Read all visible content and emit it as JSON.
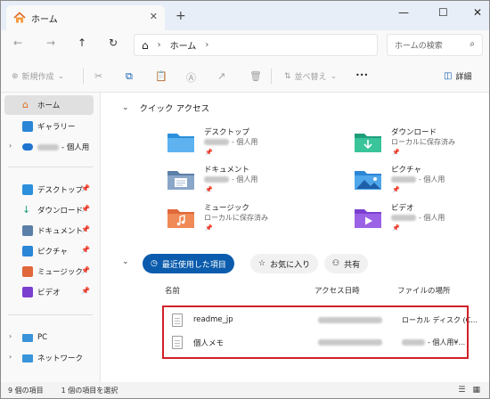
{
  "tab": {
    "title": "ホーム",
    "close": "✕",
    "new_tab": "+"
  },
  "window_controls": {
    "minimize": "—",
    "maximize": "☐",
    "close": "✕"
  },
  "nav": {
    "back": "←",
    "forward": "→",
    "up": "↑",
    "refresh": "↻"
  },
  "address": {
    "home_glyph": "⌂",
    "sep1": "›",
    "location": "ホーム",
    "sep2": "›"
  },
  "search": {
    "placeholder": "ホームの検索",
    "icon": "⌕"
  },
  "toolbar": {
    "new_label": "新規作成",
    "sort_label": "並べ替え",
    "more_label": "•••",
    "details_label": "詳細"
  },
  "sidebar": {
    "home": "ホーム",
    "gallery": "ギャラリー",
    "onedrive_suffix": "- 個人用",
    "desktop": "デスクトップ",
    "downloads": "ダウンロード",
    "documents": "ドキュメント",
    "pictures": "ピクチャ",
    "music": "ミュージック",
    "videos": "ビデオ",
    "pc": "PC",
    "network": "ネットワーク"
  },
  "quick_access": {
    "heading": "クイック アクセス",
    "items": [
      {
        "name": "デスクトップ",
        "sub": "- 個人用",
        "color": "#2b8fdc"
      },
      {
        "name": "ダウンロード",
        "sub": "ローカルに保存済み",
        "color": "#1f9e7c"
      },
      {
        "name": "ドキュメント",
        "sub": "- 個人用",
        "color": "#5b7fa8"
      },
      {
        "name": "ピクチャ",
        "sub": "- 個人用",
        "color": "#2a86d6"
      },
      {
        "name": "ミュージック",
        "sub": "ローカルに保存済み",
        "color": "#e0683a"
      },
      {
        "name": "ビデオ",
        "sub": "- 個人用",
        "color": "#7b3fd0"
      }
    ]
  },
  "filters": {
    "recent": "最近使用した項目",
    "favorites": "お気に入り",
    "shared": "共有"
  },
  "columns": {
    "name": "名前",
    "access_date": "アクセス日時",
    "location": "ファイルの場所"
  },
  "files": [
    {
      "name": "readme_jp",
      "location": "ローカル ディスク (C..."
    },
    {
      "name": "個人メモ",
      "location": "- 個人用¥..."
    }
  ],
  "status": {
    "count": "9 個の項目",
    "selected": "1 個の項目を選択"
  },
  "colors": {
    "accent": "#0b5cad",
    "highlight": "#d0202a"
  }
}
